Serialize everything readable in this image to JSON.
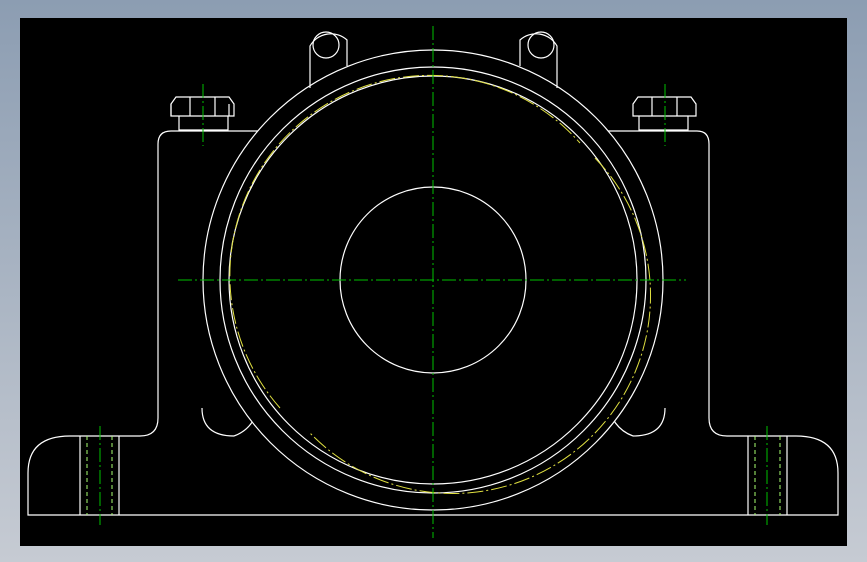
{
  "drawing": {
    "background": "#000000",
    "line_color": "#ffffff",
    "center_color": "#00c000",
    "hidden_color": "#a8ff70",
    "thread_color": "#e0e040"
  }
}
